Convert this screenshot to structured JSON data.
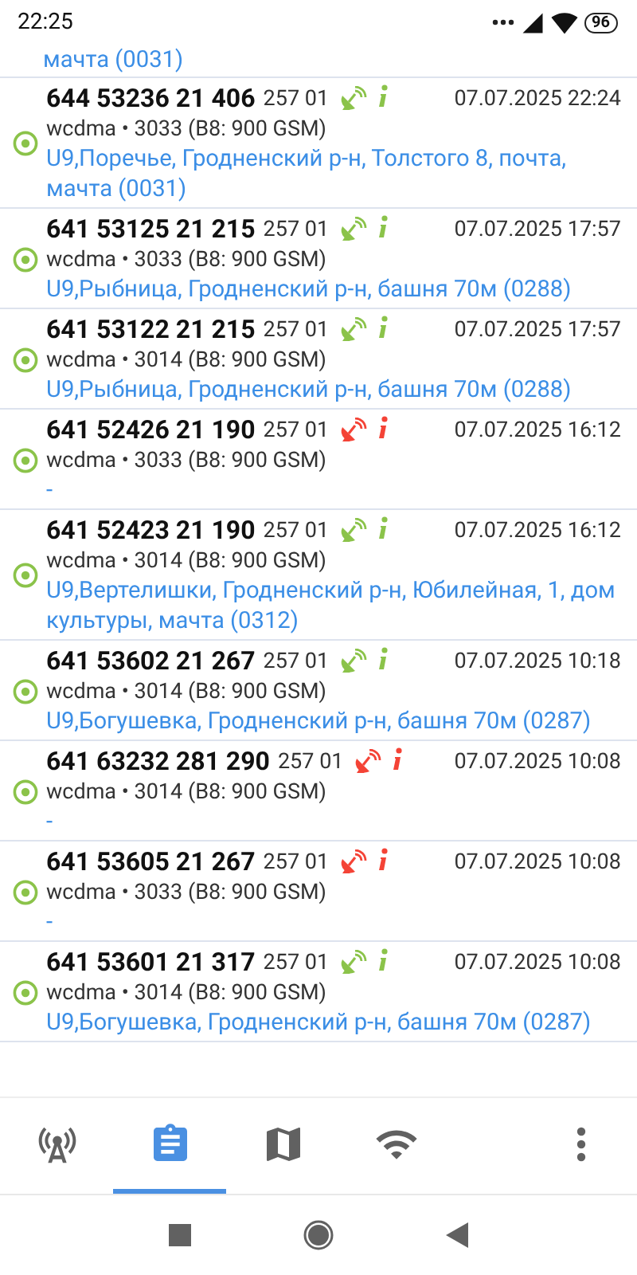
{
  "status_bar": {
    "time": "22:25",
    "battery": "96"
  },
  "top_fragment": "мачта (0031)",
  "rows": [
    {
      "cell": "644 53236 21 406",
      "plmn": "257 01",
      "color": "#8bc34a",
      "date": "07.07.2025 22:24",
      "tech": "wcdma • 3033 (B8: 900 GSM)",
      "address": "U9,Поречье, Гродненский р-н, Толстого 8, почта, мачта (0031)"
    },
    {
      "cell": "641 53125 21 215",
      "plmn": "257 01",
      "color": "#8bc34a",
      "date": "07.07.2025 17:57",
      "tech": "wcdma • 3033 (B8: 900 GSM)",
      "address": "U9,Рыбница, Гродненский р-н, башня 70м (0288)"
    },
    {
      "cell": "641 53122 21 215",
      "plmn": "257 01",
      "color": "#8bc34a",
      "date": "07.07.2025 17:57",
      "tech": "wcdma • 3014 (B8: 900 GSM)",
      "address": "U9,Рыбница, Гродненский р-н, башня 70м (0288)"
    },
    {
      "cell": "641 52426 21 190",
      "plmn": "257 01",
      "color": "#f44336",
      "date": "07.07.2025 16:12",
      "tech": "wcdma • 3033 (B8: 900 GSM)",
      "address": "-"
    },
    {
      "cell": "641 52423 21 190",
      "plmn": "257 01",
      "color": "#8bc34a",
      "date": "07.07.2025 16:12",
      "tech": "wcdma • 3014 (B8: 900 GSM)",
      "address": "U9,Вертелишки, Гродненский р-н, Юбилейная, 1, дом культуры, мачта (0312)"
    },
    {
      "cell": "641 53602 21 267",
      "plmn": "257 01",
      "color": "#8bc34a",
      "date": "07.07.2025 10:18",
      "tech": "wcdma • 3014 (B8: 900 GSM)",
      "address": "U9,Богушевка, Гродненский р-н, башня 70м (0287)"
    },
    {
      "cell": "641 63232 281 290",
      "plmn": "257 01",
      "color": "#f44336",
      "date": "07.07.2025 10:08",
      "tech": "wcdma • 3014 (B8: 900 GSM)",
      "address": "-"
    },
    {
      "cell": "641 53605 21 267",
      "plmn": "257 01",
      "color": "#f44336",
      "date": "07.07.2025 10:08",
      "tech": "wcdma • 3033 (B8: 900 GSM)",
      "address": "-"
    },
    {
      "cell": "641 53601 21 317",
      "plmn": "257 01",
      "color": "#8bc34a",
      "date": "07.07.2025 10:08",
      "tech": "wcdma • 3014 (B8: 900 GSM)",
      "address": "U9,Богушевка, Гродненский р-н, башня 70м (0287)"
    }
  ],
  "tabs": [
    {
      "kind": "tower",
      "selected": false
    },
    {
      "kind": "log",
      "selected": true
    },
    {
      "kind": "map",
      "selected": false
    },
    {
      "kind": "wifi",
      "selected": false
    },
    {
      "kind": "more",
      "selected": false
    }
  ]
}
